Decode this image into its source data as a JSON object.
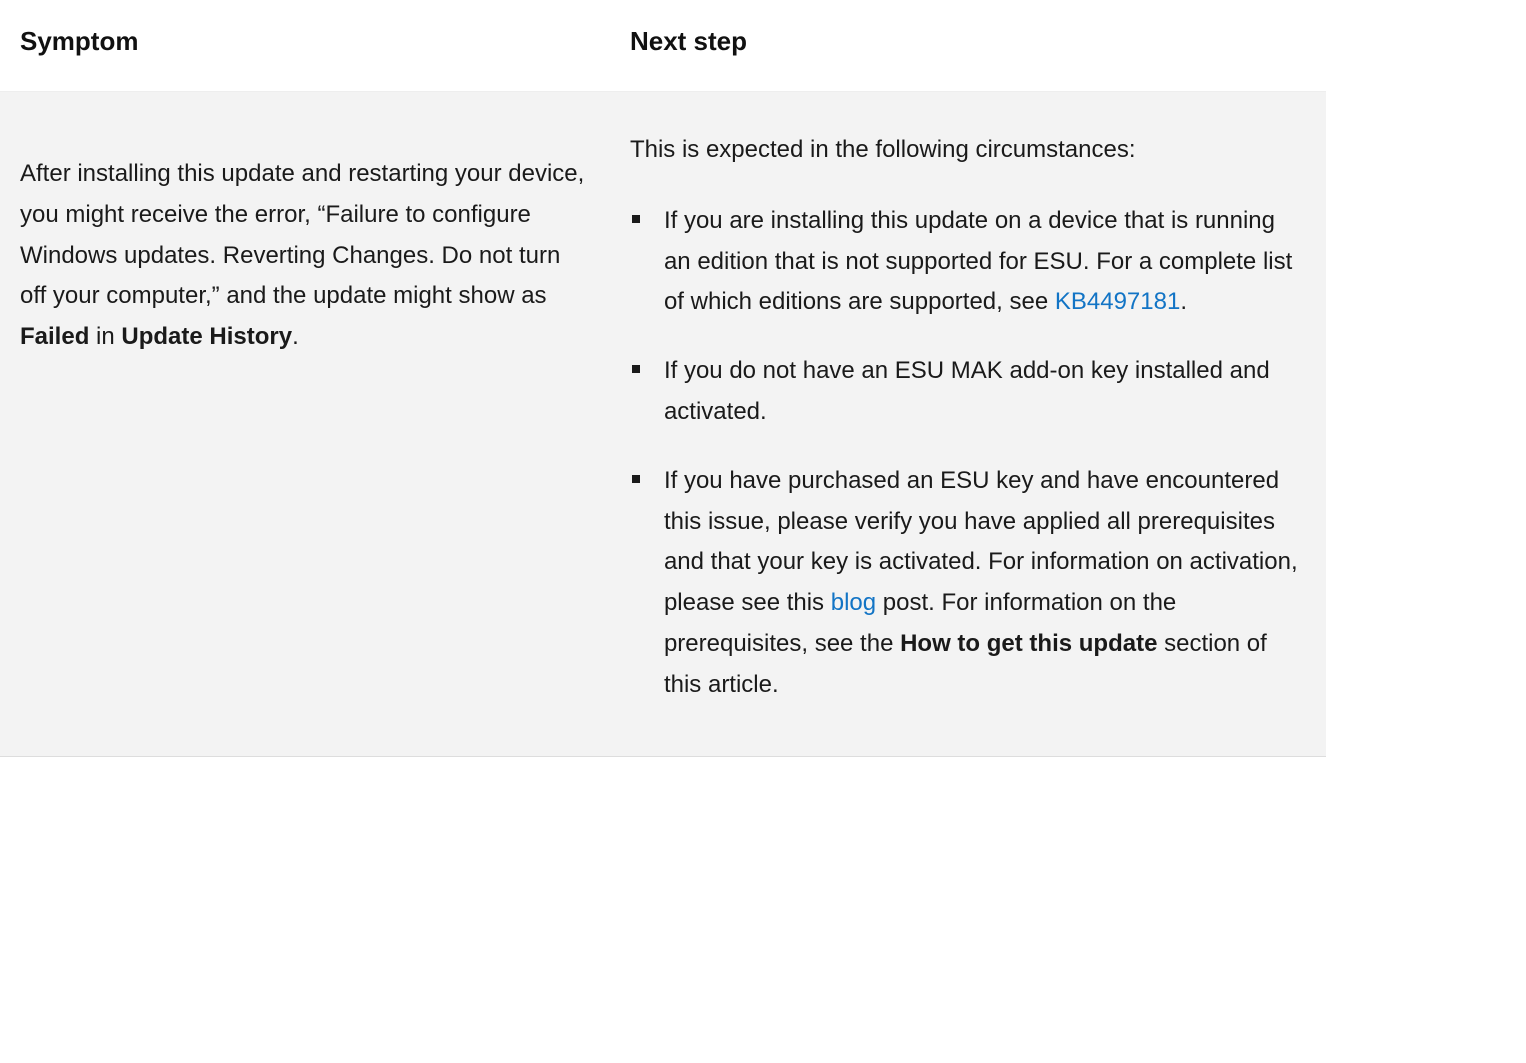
{
  "table": {
    "headers": {
      "symptom": "Symptom",
      "next_step": "Next step"
    },
    "row": {
      "symptom": {
        "pre": "After installing this update and restarting your device, you might receive the error, “Failure to configure Windows updates. Reverting Changes. Do not turn off your computer,” and the update might show as ",
        "bold1": "Failed",
        "mid": " in ",
        "bold2": "Update History",
        "post": "."
      },
      "next_step": {
        "intro": "This is expected in the following circumstances:",
        "bullet1": {
          "pre": "If you are installing this update on a device that is running an edition that is not supported for ESU. For a complete list of which editions are supported, see ",
          "link": "KB4497181",
          "post": "."
        },
        "bullet2": {
          "text": "If you do not have an ESU MAK add-on key installed and activated."
        },
        "bullet3": {
          "pre": "If you have purchased an ESU key and have encountered this issue, please verify you have applied all prerequisites and that your key is activated. For information on activation, please see this ",
          "link": "blog",
          "mid": " post. For information on the prerequisites, see the ",
          "bold": "How to get this update",
          "post": " section of this article."
        }
      }
    }
  }
}
